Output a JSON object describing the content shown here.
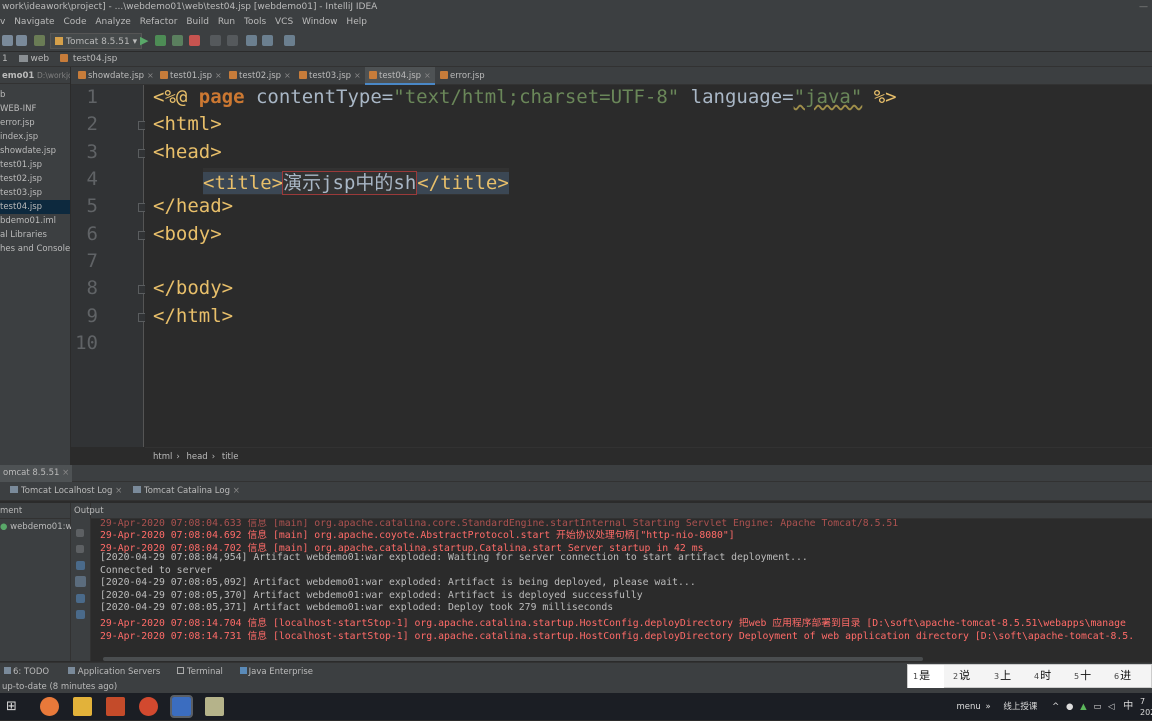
{
  "titlebar": {
    "text": "work\\ideawork\\project] - ...\\webdemo01\\web\\test04.jsp [webdemo01] - IntelliJ IDEA"
  },
  "menu": [
    "v",
    "Navigate",
    "Code",
    "Analyze",
    "Refactor",
    "Build",
    "Run",
    "Tools",
    "VCS",
    "Window",
    "Help"
  ],
  "toolbar": {
    "run_config": "Tomcat 8.5.51"
  },
  "navbar": {
    "crumbs": [
      "1",
      "web",
      "test04.jsp"
    ]
  },
  "project": {
    "header": "emo01",
    "header_path": "D:\\workjde",
    "items": [
      "b",
      "WEB-INF",
      "error.jsp",
      "index.jsp",
      "showdate.jsp",
      "test01.jsp",
      "test02.jsp",
      "test03.jsp",
      "test04.jsp",
      "bdemo01.iml",
      "al Libraries",
      "hes and Consoles"
    ],
    "selected_index": 8
  },
  "tabs": [
    {
      "label": "showdate.jsp",
      "active": false
    },
    {
      "label": "test01.jsp",
      "active": false
    },
    {
      "label": "test02.jsp",
      "active": false
    },
    {
      "label": "test03.jsp",
      "active": false
    },
    {
      "label": "test04.jsp",
      "active": true
    },
    {
      "label": "error.jsp",
      "active": false
    }
  ],
  "editor": {
    "line_numbers": [
      "1",
      "2",
      "3",
      "4",
      "5",
      "6",
      "7",
      "8",
      "9",
      "10"
    ],
    "line1": {
      "open": "<%@ ",
      "kw": "page",
      "attr1": " contentType=",
      "val1": "\"text/html;charset=UTF-8\"",
      "attr2": " language=",
      "val2": "\"java\"",
      "close": " %>"
    },
    "line2": "<html>",
    "line3": "<head>",
    "line4": {
      "open": "<title>",
      "text": "演示jsp中的sh",
      "close": "</title>"
    },
    "line5": "</head>",
    "line6": "<body>",
    "line8": "</body>",
    "line9": "</html>"
  },
  "breadcrumb": [
    "html",
    "head",
    "title"
  ],
  "run": {
    "header": "omcat 8.5.51",
    "log_tabs": [
      "Tomcat Localhost Log",
      "Tomcat Catalina Log"
    ],
    "left_header": "ment",
    "output_header": "Output",
    "deployment": "webdemo01:wa"
  },
  "console": {
    "lines": [
      {
        "text": "29-Apr-2020 07:08:04.692 信息 [main] org.apache.coyote.AbstractProtocol.start 开始协议处理句柄[\"http-nio-8080\"]",
        "error": true
      },
      {
        "text": "29-Apr-2020 07:08:04.702 信息 [main] org.apache.catalina.startup.Catalina.start Server startup in 42 ms",
        "error": true
      },
      {
        "text": "[2020-04-29 07:08:04,954] Artifact webdemo01:war exploded: Waiting for server connection to start artifact deployment...",
        "error": false
      },
      {
        "text": "Connected to server",
        "error": false
      },
      {
        "text": "[2020-04-29 07:08:05,092] Artifact webdemo01:war exploded: Artifact is being deployed, please wait...",
        "error": false
      },
      {
        "text": "[2020-04-29 07:08:05,370] Artifact webdemo01:war exploded: Artifact is deployed successfully",
        "error": false
      },
      {
        "text": "[2020-04-29 07:08:05,371] Artifact webdemo01:war exploded: Deploy took 279 milliseconds",
        "error": false
      },
      {
        "text": "29-Apr-2020 07:08:14.704 信息 [localhost-startStop-1] org.apache.catalina.startup.HostConfig.deployDirectory 把web 应用程序部署到目录 [D:\\soft\\apache-tomcat-8.5.51\\webapps\\manage",
        "error": true
      },
      {
        "text": "29-Apr-2020 07:08:14.731 信息 [localhost-startStop-1] org.apache.catalina.startup.HostConfig.deployDirectory Deployment of web application directory [D:\\soft\\apache-tomcat-8.5.",
        "error": true
      }
    ]
  },
  "toolstrip": [
    "6: TODO",
    "Application Servers",
    "Terminal",
    "Java Enterprise"
  ],
  "status": "up-to-date (8 minutes ago)",
  "ime": {
    "candidates": [
      {
        "n": "1",
        "c": "是"
      },
      {
        "n": "2",
        "c": "说"
      },
      {
        "n": "3",
        "c": "上"
      },
      {
        "n": "4",
        "c": "时"
      },
      {
        "n": "5",
        "c": "十"
      },
      {
        "n": "6",
        "c": "进"
      }
    ]
  },
  "taskbar": {
    "menu": "menu",
    "search": "线上授课",
    "lang": "中",
    "clock": "7",
    "year": "202"
  },
  "colors": {
    "accent": "#4a88c7",
    "error_text": "#ff6b68",
    "tag": "#e8bf6a",
    "string": "#6a8759",
    "keyword": "#cc7832"
  }
}
